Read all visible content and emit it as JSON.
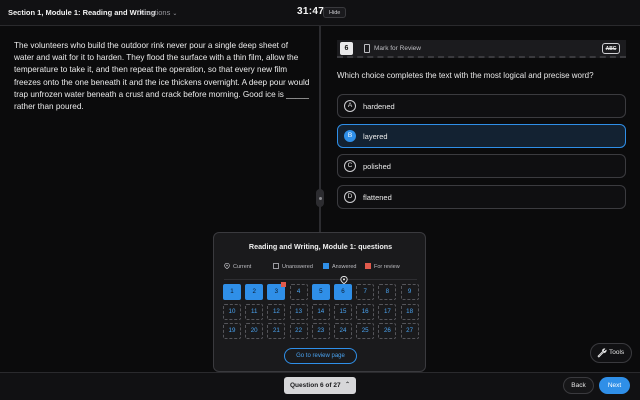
{
  "header": {
    "section_title": "Section 1, Module 1: Reading and Writing",
    "directions_label": "Directions",
    "timer": "31:47",
    "hide_label": "Hide"
  },
  "passage": {
    "text": "The volunteers who build the outdoor rink never pour a single deep sheet of water and wait for it to harden. They flood the surface with a thin film, allow the temperature to take it, and then repeat the operation, so that every new film freezes onto the one beneath it and the ice thickens overnight. A deep pour would trap unfrozen water beneath a crust and crack before morning. Good ice is _____ rather than poured."
  },
  "question": {
    "number": "6",
    "mark_for_review": "Mark for Review",
    "abc_label": "ABC",
    "prompt": "Which choice completes the text with the most logical and precise word?",
    "choices": [
      {
        "letter": "A",
        "text": "hardened",
        "selected": false
      },
      {
        "letter": "B",
        "text": "layered",
        "selected": true
      },
      {
        "letter": "C",
        "text": "polished",
        "selected": false
      },
      {
        "letter": "D",
        "text": "flattened",
        "selected": false
      }
    ]
  },
  "popup": {
    "title": "Reading and Writing, Module 1: questions",
    "legend": {
      "current": "Current",
      "unanswered": "Unanswered",
      "answered": "Answered",
      "for_review": "For review"
    },
    "questions": [
      {
        "n": "1",
        "answered": true
      },
      {
        "n": "2",
        "answered": true
      },
      {
        "n": "3",
        "answered": true,
        "review": true
      },
      {
        "n": "4",
        "answered": false
      },
      {
        "n": "5",
        "answered": true
      },
      {
        "n": "6",
        "answered": true,
        "current": true
      },
      {
        "n": "7",
        "answered": false
      },
      {
        "n": "8",
        "answered": false
      },
      {
        "n": "9",
        "answered": false
      },
      {
        "n": "10",
        "answered": false
      },
      {
        "n": "11",
        "answered": false
      },
      {
        "n": "12",
        "answered": false
      },
      {
        "n": "13",
        "answered": false
      },
      {
        "n": "14",
        "answered": false
      },
      {
        "n": "15",
        "answered": false
      },
      {
        "n": "16",
        "answered": false
      },
      {
        "n": "17",
        "answered": false
      },
      {
        "n": "18",
        "answered": false
      },
      {
        "n": "19",
        "answered": false
      },
      {
        "n": "20",
        "answered": false
      },
      {
        "n": "21",
        "answered": false
      },
      {
        "n": "22",
        "answered": false
      },
      {
        "n": "23",
        "answered": false
      },
      {
        "n": "24",
        "answered": false
      },
      {
        "n": "25",
        "answered": false
      },
      {
        "n": "26",
        "answered": false
      },
      {
        "n": "27",
        "answered": false
      }
    ],
    "review_button": "Go to review page"
  },
  "tools": {
    "label": "Tools",
    "icon": "wrench-icon"
  },
  "footer": {
    "question_nav": "Question 6 of 27",
    "back_label": "Back",
    "next_label": "Next"
  },
  "colors": {
    "accent": "#2f8fe8",
    "review_flag": "#e05a4c",
    "background": "#0b0b0c"
  }
}
